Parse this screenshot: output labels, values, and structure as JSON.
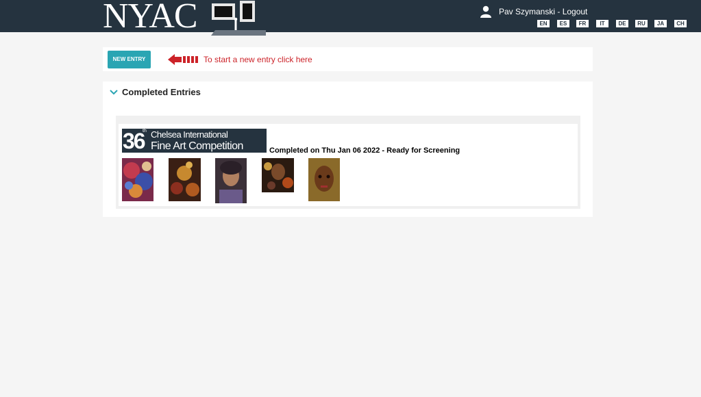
{
  "header": {
    "logo_text": "NYAC",
    "user_label": "Pav Szymanski - Logout",
    "languages": [
      "EN",
      "ES",
      "FR",
      "IT",
      "DE",
      "RU",
      "JA",
      "CH"
    ]
  },
  "new_entry": {
    "button_label": "NEW ENTRY",
    "hint": "To start a new entry click here"
  },
  "completed": {
    "title": "Completed Entries",
    "entries": [
      {
        "banner": {
          "number": "36",
          "suffix": "th",
          "line1": "Chelsea International",
          "line2": "Fine Art Competition"
        },
        "status": "Completed on Thu Jan 06 2022 - Ready for Screening",
        "thumbnails": [
          "artwork-1",
          "artwork-2",
          "artwork-3",
          "artwork-4",
          "artwork-5"
        ]
      }
    ]
  },
  "colors": {
    "header_bg": "#25333f",
    "button_bg": "#2aa5b3",
    "hint_red": "#cc2228",
    "chevron": "#2aa5b3"
  }
}
